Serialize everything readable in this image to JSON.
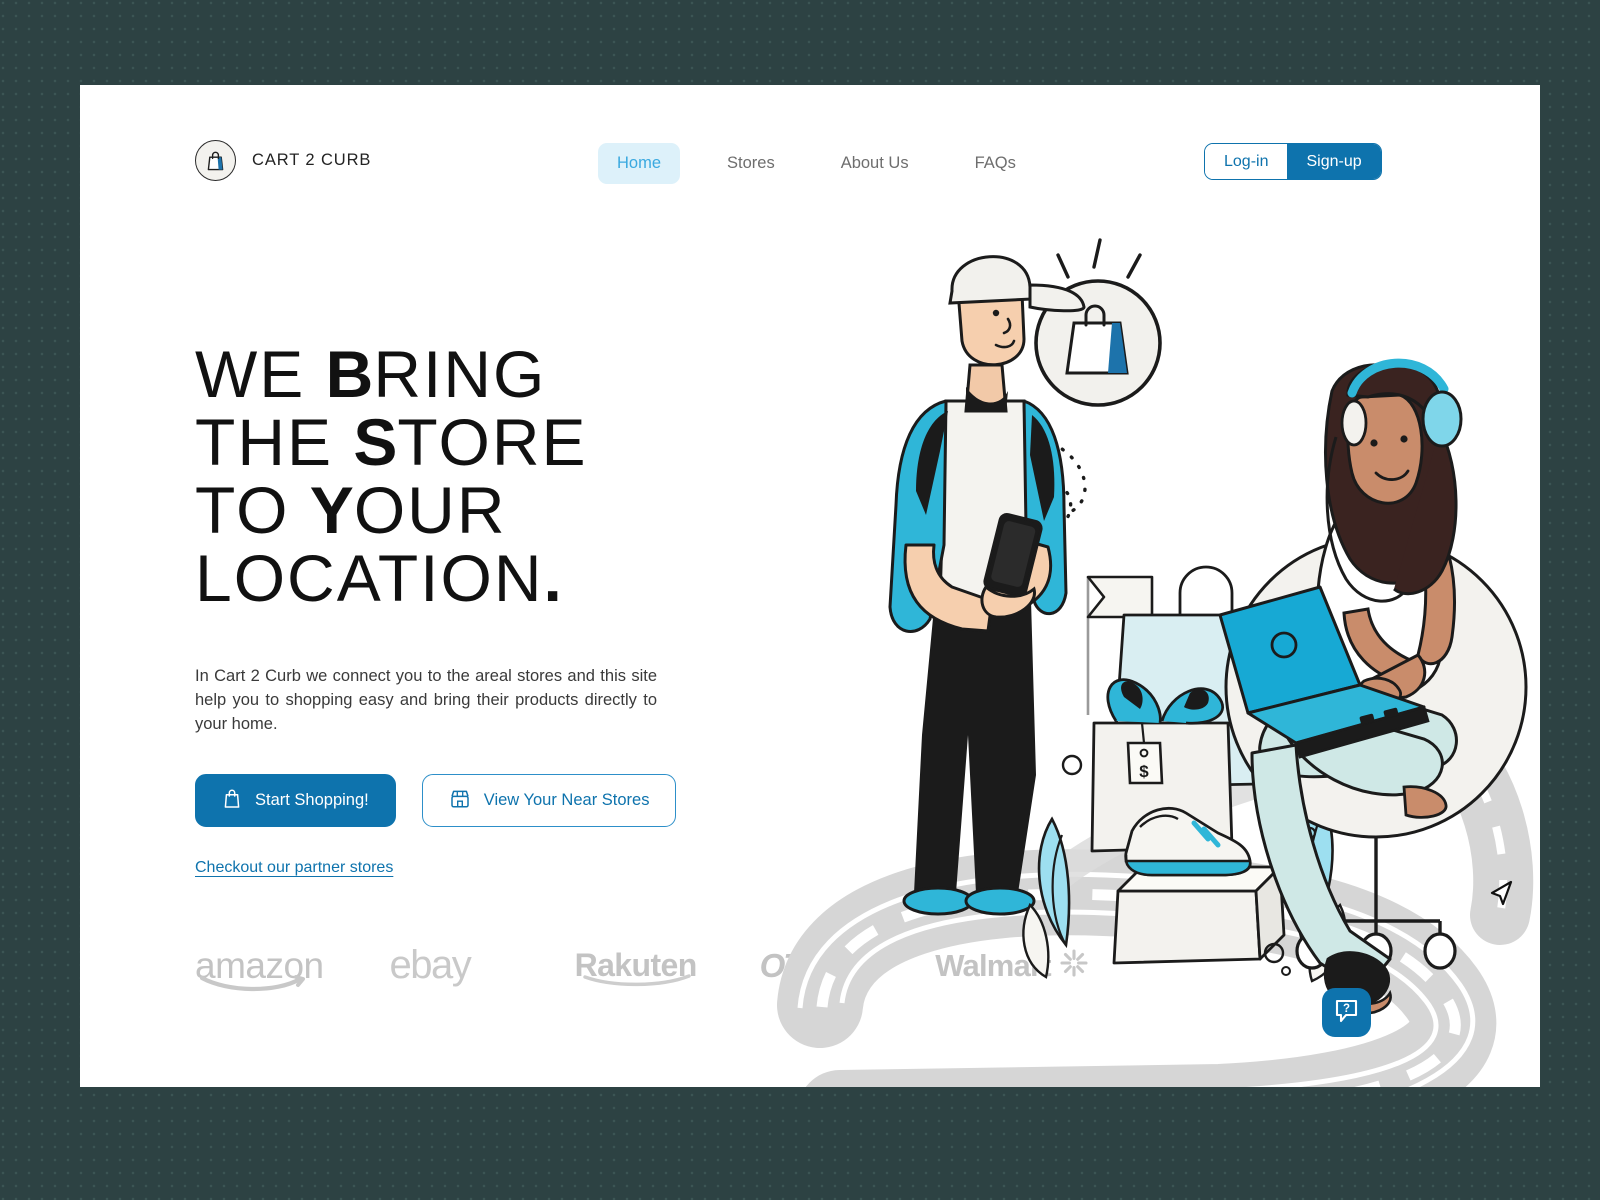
{
  "theme": {
    "page_background": "#2d4243",
    "card_background": "#ffffff",
    "accent_blue": "#0e73ad",
    "accent_light_blue": "#3aa9e0",
    "nav_active_bg": "#ddf1fa",
    "illustration_cyan": "#2fb6d8",
    "logo_gray": "#c3c3c3",
    "road_gray": "#d4d4d4"
  },
  "header": {
    "brand": {
      "name": "CART 2 CURB",
      "mark_icon": "shopping-bag-icon"
    },
    "nav": [
      {
        "label": "Home",
        "active": true
      },
      {
        "label": "Stores",
        "active": false
      },
      {
        "label": "About Us",
        "active": false
      },
      {
        "label": "FAQs",
        "active": false
      }
    ],
    "auth": {
      "login_label": "Log-in",
      "signup_label": "Sign-up"
    }
  },
  "hero": {
    "headline_lines": [
      {
        "id": 0,
        "text": "WE BRING"
      },
      {
        "id": 1,
        "text": "THE STORE"
      },
      {
        "id": 2,
        "text": "TO YOUR"
      },
      {
        "id": 3,
        "text": "LOCATION."
      }
    ],
    "headline_plain": "WE BRING THE STORE TO YOUR LOCATION.",
    "lede": "In Cart 2 Curb we connect you to the areal stores and this site help you to shopping easy and bring their products directly to your home.",
    "primary_cta": {
      "label": "Start Shopping!",
      "icon": "shopping-bag-icon"
    },
    "secondary_cta": {
      "label": "View Your Near Stores",
      "icon": "storefront-icon"
    },
    "partner_link": "Checkout our partner stores"
  },
  "partners": [
    {
      "name": "amazon"
    },
    {
      "name": "ebay"
    },
    {
      "name": "Rakuten"
    },
    {
      "name": "OTTO"
    },
    {
      "name": "Walmart"
    }
  ],
  "illustration": {
    "alt": "Delivery courier with phone, shopping bags and gift boxes with price tags, woman with headphones using a laptop in an egg chair, winding road",
    "price_tag_symbol": "$"
  },
  "help_button": {
    "icon": "question-chat-icon",
    "label": "?"
  }
}
